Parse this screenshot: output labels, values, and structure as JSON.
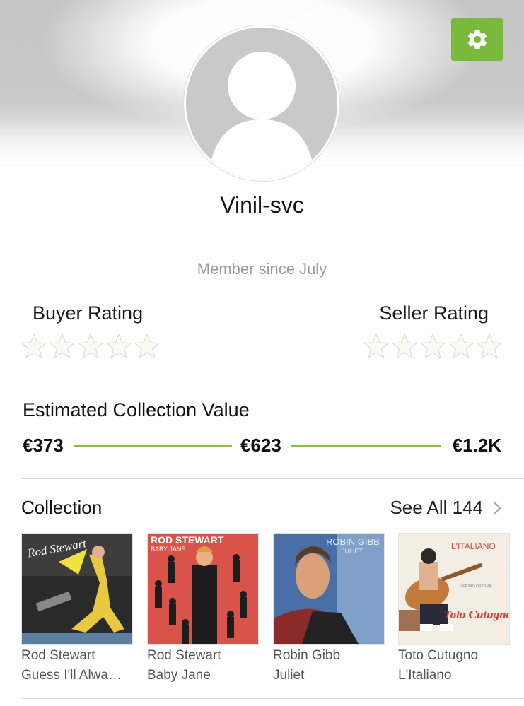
{
  "profile": {
    "username": "Vinil-svc",
    "member_since": "Member since July"
  },
  "ratings": {
    "buyer_label": "Buyer Rating",
    "seller_label": "Seller Rating",
    "buyer_stars": 0,
    "seller_stars": 0,
    "max_stars": 5
  },
  "collection_value": {
    "title": "Estimated Collection Value",
    "low": "€373",
    "mid": "€623",
    "high": "€1.2K"
  },
  "collection": {
    "title": "Collection",
    "see_all": "See All 144",
    "items": [
      {
        "artist": "Rod Stewart",
        "title": "Guess I'll Alwa…",
        "cover_text": "Rod Stewart"
      },
      {
        "artist": "Rod Stewart",
        "title": "Baby Jane",
        "cover_text": "ROD STEWART",
        "cover_sub": "BABY JANE"
      },
      {
        "artist": "Robin Gibb",
        "title": "Juliet",
        "cover_text": "ROBIN GIBB",
        "cover_sub": "JULIET"
      },
      {
        "artist": "Toto Cutugno",
        "title": "L'Italiano",
        "cover_text": "L'ITALIANO",
        "cover_sub": "Toto Cutugno",
        "cover_note": "VERSÃO ORIGINAL"
      }
    ]
  },
  "icons": {
    "settings": "gear-icon",
    "see_all": "chevron-right-icon",
    "avatar": "user-placeholder-icon",
    "star": "star-outline-icon"
  },
  "colors": {
    "accent": "#7ab93b",
    "bar": "#86c23f",
    "muted_text": "#9b9b9b"
  }
}
